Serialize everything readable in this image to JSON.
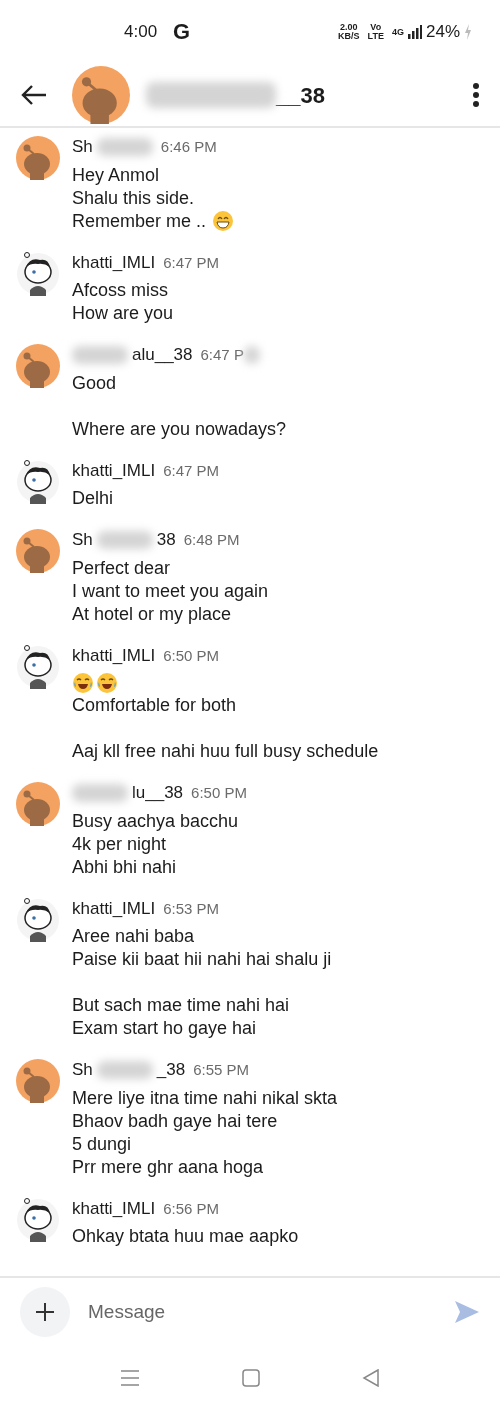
{
  "status_bar": {
    "time": "4:00",
    "google": "G",
    "speed": "2.00",
    "speed_unit": "KB/S",
    "volte_top": "Vo",
    "volte_bottom": "LTE",
    "network": "4G",
    "battery": "24%",
    "charging": true
  },
  "header": {
    "avatar": {
      "kind": "snoo"
    },
    "title_blurred": true,
    "title_after": "__38"
  },
  "messages": [
    {
      "avatar": {
        "kind": "snoo"
      },
      "name_before": "Sh",
      "name_blurred": true,
      "time": "6:46 PM",
      "time_blurred": false,
      "blocks": [
        {
          "lines": [
            "Hey Anmol",
            "Shalu this side.",
            {
              "text": "Remember me ..",
              "emoji": [
                {
                  "kind": "grin"
                }
              ]
            }
          ]
        }
      ]
    },
    {
      "avatar": {
        "kind": "cartoon"
      },
      "name_before": "khatti_IMLI",
      "name_blurred": false,
      "time": "6:47 PM",
      "time_blurred": false,
      "blocks": [
        {
          "lines": [
            "Afcoss miss",
            "How are you"
          ]
        }
      ]
    },
    {
      "avatar": {
        "kind": "snoo"
      },
      "name_blurred": true,
      "name_after": "alu__38",
      "time": "6:47 P",
      "time_blurred": true,
      "blocks": [
        {
          "lines": [
            "Good"
          ]
        },
        {
          "lines": [
            "Where are you nowadays?"
          ]
        }
      ]
    },
    {
      "avatar": {
        "kind": "cartoon"
      },
      "name_before": "khatti_IMLI",
      "name_blurred": false,
      "time": "6:47 PM",
      "time_blurred": false,
      "blocks": [
        {
          "lines": [
            "Delhi"
          ]
        }
      ]
    },
    {
      "avatar": {
        "kind": "snoo"
      },
      "name_before": "Sh",
      "name_blurred": true,
      "name_after": "38",
      "time": "6:48 PM",
      "time_blurred": false,
      "blocks": [
        {
          "lines": [
            "Perfect dear",
            "I want to meet you again",
            "At hotel or my place"
          ]
        }
      ]
    },
    {
      "avatar": {
        "kind": "cartoon"
      },
      "name_before": "khatti_IMLI",
      "name_blurred": false,
      "time": "6:50 PM",
      "time_blurred": false,
      "blocks": [
        {
          "lines": [
            {
              "emoji": [
                {
                  "kind": "joy"
                },
                {
                  "kind": "joy"
                }
              ]
            },
            "Comfortable for both"
          ]
        },
        {
          "lines": [
            "Aaj kll free nahi huu full busy schedule"
          ]
        }
      ]
    },
    {
      "avatar": {
        "kind": "snoo"
      },
      "name_blurred": true,
      "name_after": "lu__38",
      "time": "6:50 PM",
      "time_blurred": false,
      "blocks": [
        {
          "lines": [
            "Busy aachya bacchu",
            "4k per night",
            "Abhi bhi nahi"
          ]
        }
      ]
    },
    {
      "avatar": {
        "kind": "cartoon"
      },
      "name_before": "khatti_IMLI",
      "name_blurred": false,
      "time": "6:53 PM",
      "time_blurred": false,
      "blocks": [
        {
          "lines": [
            "Aree nahi baba",
            "Paise kii baat hii nahi hai shalu ji"
          ]
        },
        {
          "lines": [
            "But sach mae time nahi hai",
            "Exam start ho gaye hai"
          ]
        }
      ]
    },
    {
      "avatar": {
        "kind": "snoo"
      },
      "name_before": "Sh",
      "name_blurred": true,
      "name_after": "_38",
      "time": "6:55 PM",
      "time_blurred": false,
      "blocks": [
        {
          "lines": [
            "Mere liye itna time nahi nikal skta",
            "Bhaov badh gaye hai tere",
            "5 dungi",
            "Prr mere ghr aana hoga"
          ]
        }
      ]
    },
    {
      "avatar": {
        "kind": "cartoon"
      },
      "name_before": "khatti_IMLI",
      "name_blurred": false,
      "time": "6:56 PM",
      "time_blurred": false,
      "blocks": [
        {
          "lines": [
            "Ohkay btata huu mae aapko"
          ]
        }
      ]
    }
  ],
  "composer": {
    "placeholder": "Message"
  }
}
